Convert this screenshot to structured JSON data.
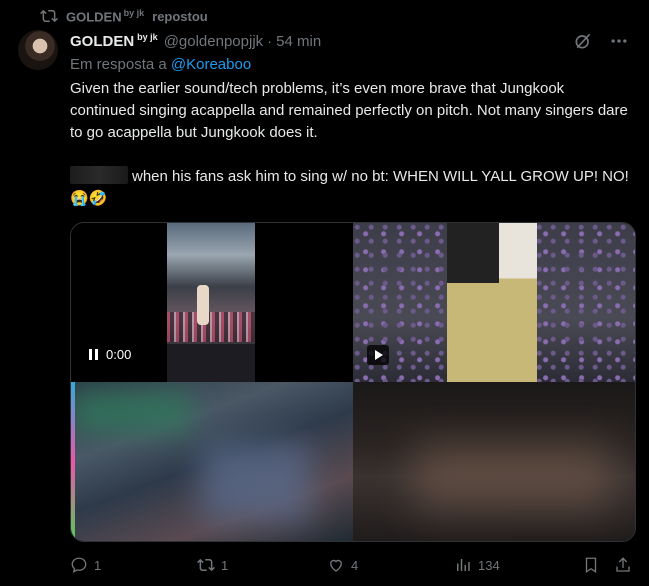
{
  "repost": {
    "user": "GOLDEN",
    "user_sup": "by jk",
    "label": "repostou"
  },
  "tweet": {
    "display_name": "GOLDEN",
    "name_sup": "by jk",
    "handle": "@goldenpopjjk",
    "separator": "·",
    "time": "54 min",
    "reply_prefix": "Em resposta a",
    "reply_mention": "@Koreaboo",
    "paragraph1": "Given the earlier sound/tech problems, it’s even more brave that Jungkook continued singing acappella and remained perfectly on pitch. Not many singers dare to go acappella but Jungkook does it.",
    "paragraph2": "when his fans ask him to sing w/ no bt: WHEN WILL YALL GROW UP! NO!😭🤣"
  },
  "media": {
    "video1_time": "0:00"
  },
  "actions": {
    "replies": "1",
    "reposts": "1",
    "likes": "4",
    "views": "134"
  },
  "colors": {
    "accent": "#1d9bf0",
    "muted": "#71767b",
    "text": "#e7e9ea",
    "bg": "#000000"
  }
}
